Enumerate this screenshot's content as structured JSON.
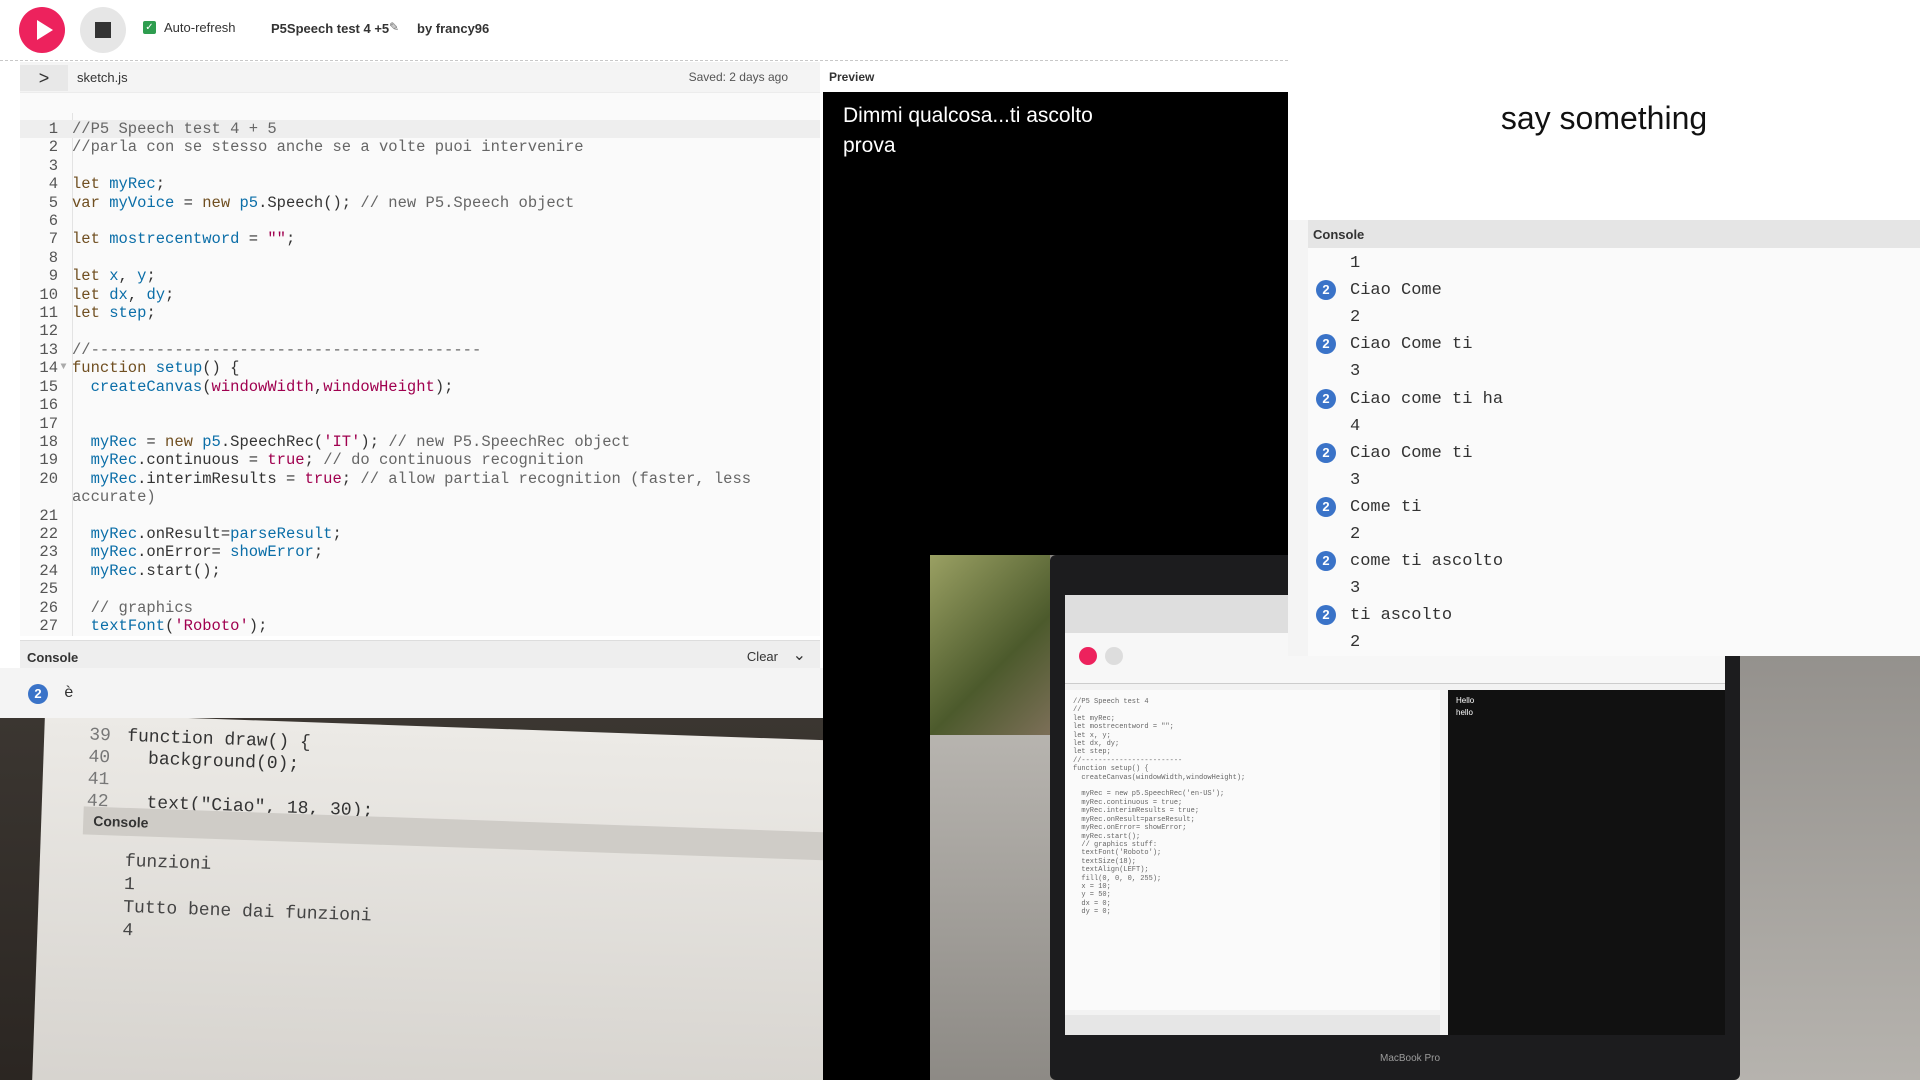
{
  "toolbar": {
    "auto_refresh_label": "Auto-refresh",
    "project_name": "P5Speech test 4 +5",
    "owner": "by francy96"
  },
  "filebar": {
    "toggle": ">",
    "filename": "sketch.js",
    "saved": "Saved: 2 days ago",
    "preview_label": "Preview"
  },
  "editor": {
    "lines": [
      {
        "n": "1",
        "html": "<span class='cmt'>//P5 Speech test 4 + 5</span>"
      },
      {
        "n": "2",
        "html": "<span class='cmt'>//parla con se stesso anche se a volte puoi intervenire</span>"
      },
      {
        "n": "3",
        "html": ""
      },
      {
        "n": "4",
        "html": "<span class='kw'>let</span> <span class='var'>myRec</span>;"
      },
      {
        "n": "5",
        "html": "<span class='kw'>var</span> <span class='var'>myVoice</span> = <span class='kw'>new</span> <span class='var'>p5</span>.Speech(); <span class='cmt'>// new P5.Speech object</span>"
      },
      {
        "n": "6",
        "html": ""
      },
      {
        "n": "7",
        "html": "<span class='kw'>let</span> <span class='var'>mostrecentword</span> = <span class='str'>\"\"</span>;"
      },
      {
        "n": "8",
        "html": ""
      },
      {
        "n": "9",
        "html": "<span class='kw'>let</span> <span class='var'>x</span>, <span class='var'>y</span>;"
      },
      {
        "n": "10",
        "html": "<span class='kw'>let</span> <span class='var'>dx</span>, <span class='var'>dy</span>;"
      },
      {
        "n": "11",
        "html": "<span class='kw'>let</span> <span class='var'>step</span>;"
      },
      {
        "n": "12",
        "html": ""
      },
      {
        "n": "13",
        "html": "<span class='cmt'>//------------------------------------------</span>"
      },
      {
        "n": "14",
        "fold": true,
        "html": "<span class='kw'>function</span> <span class='var'>setup</span>() {"
      },
      {
        "n": "15",
        "html": "  <span class='var'>createCanvas</span>(<span class='str'>windowWidth</span>,<span class='str'>windowHeight</span>);"
      },
      {
        "n": "16",
        "html": ""
      },
      {
        "n": "17",
        "html": ""
      },
      {
        "n": "18",
        "html": "  <span class='var'>myRec</span> = <span class='kw'>new</span> <span class='var'>p5</span>.SpeechRec(<span class='str'>'IT'</span>); <span class='cmt'>// new P5.SpeechRec object</span>"
      },
      {
        "n": "19",
        "html": "  <span class='var'>myRec</span>.continuous = <span class='str'>true</span>; <span class='cmt'>// do continuous recognition</span>"
      },
      {
        "n": "20",
        "html": "  <span class='var'>myRec</span>.interimResults = <span class='str'>true</span>; <span class='cmt'>// allow partial recognition (faster, less</span>"
      },
      {
        "n": "",
        "html": "<span class='cmt'>accurate)</span>"
      },
      {
        "n": "21",
        "html": ""
      },
      {
        "n": "22",
        "html": "  <span class='var'>myRec</span>.onResult=<span class='var'>parseResult</span>;"
      },
      {
        "n": "23",
        "html": "  <span class='var'>myRec</span>.onError= <span class='var'>showError</span>;"
      },
      {
        "n": "24",
        "html": "  <span class='var'>myRec</span>.start();"
      },
      {
        "n": "25",
        "html": ""
      },
      {
        "n": "26",
        "html": "  <span class='cmt'>// graphics</span>"
      },
      {
        "n": "27",
        "html": "  <span class='var'>textFont</span>(<span class='str'>'Roboto'</span>);"
      }
    ]
  },
  "console_bottom": {
    "title": "Console",
    "clear_label": "Clear",
    "badge": "2",
    "text": "è"
  },
  "preview": {
    "line1": "Dimmi qualcosa...ti ascolto",
    "line2": "prova"
  },
  "photo_left": {
    "code": [
      {
        "n": "39",
        "t": "function draw() {"
      },
      {
        "n": "40",
        "t": "  background(0);"
      },
      {
        "n": "41",
        "t": ""
      },
      {
        "n": "42",
        "t": "  text(\"Ciao\", 18, 30);"
      }
    ],
    "console_label": "Console",
    "output": [
      "funzioni",
      "1",
      "Tutto bene dai funzioni",
      "4"
    ]
  },
  "photo_right": {
    "macbook_label": "MacBook Pro",
    "preview_lines": [
      "Hello",
      "hello"
    ]
  },
  "say_panel": {
    "text": "say something"
  },
  "console_right": {
    "title": "Console",
    "rows": [
      {
        "badge": "",
        "text": "1"
      },
      {
        "badge": "2",
        "text": "Ciao Come"
      },
      {
        "badge": "",
        "text": "2"
      },
      {
        "badge": "2",
        "text": "Ciao Come ti"
      },
      {
        "badge": "",
        "text": "3"
      },
      {
        "badge": "2",
        "text": "Ciao come ti ha"
      },
      {
        "badge": "",
        "text": "4"
      },
      {
        "badge": "2",
        "text": "Ciao Come ti"
      },
      {
        "badge": "",
        "text": "3"
      },
      {
        "badge": "2",
        "text": "Come ti"
      },
      {
        "badge": "",
        "text": "2"
      },
      {
        "badge": "2",
        "text": "come ti ascolto"
      },
      {
        "badge": "",
        "text": "3"
      },
      {
        "badge": "2",
        "text": "ti ascolto"
      },
      {
        "badge": "",
        "text": "2"
      }
    ]
  },
  "colors": {
    "play": "#ed225d",
    "badge": "#3a73c8",
    "preview_bg": "#000000"
  }
}
